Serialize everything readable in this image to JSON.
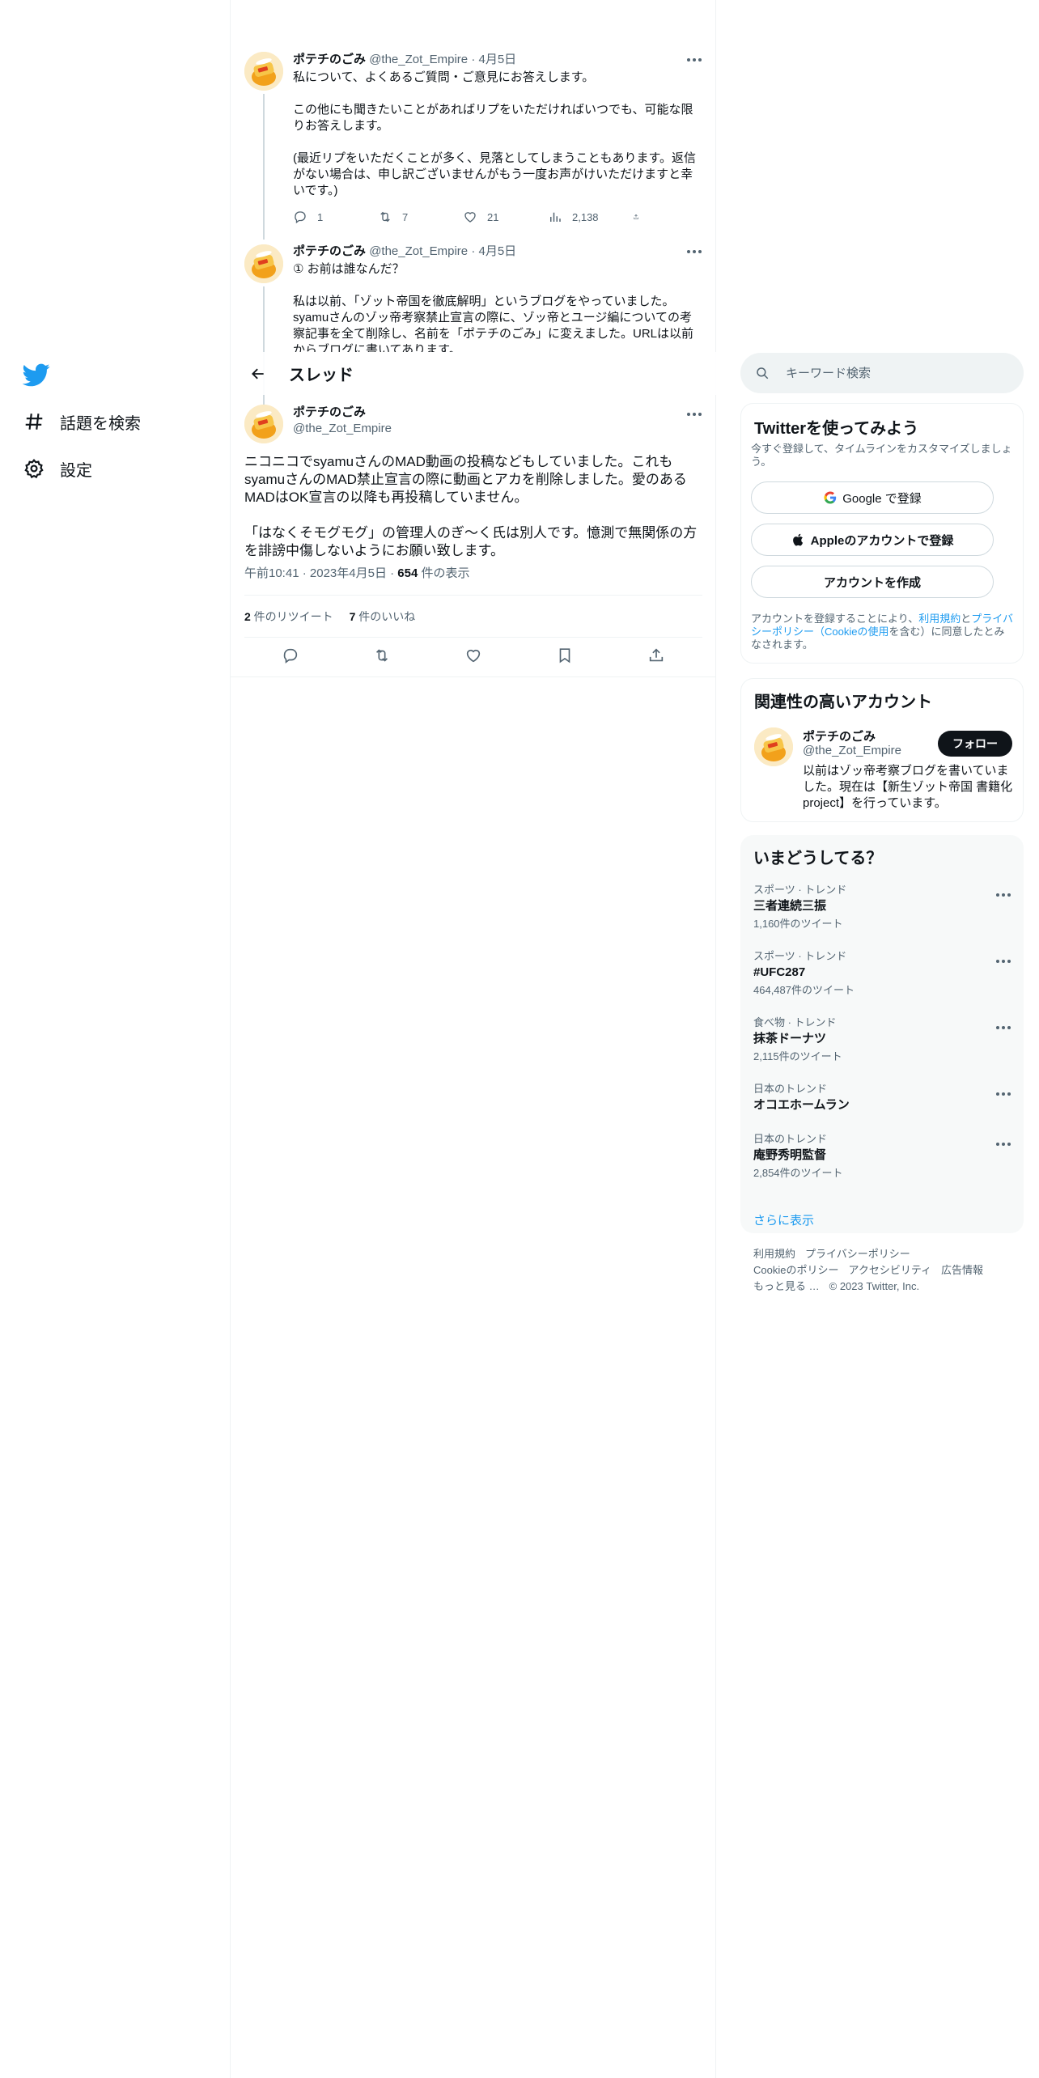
{
  "nav": {
    "items": [
      {
        "label": "話題を検索",
        "icon": "hashtag-icon"
      },
      {
        "label": "設定",
        "icon": "gear-icon"
      }
    ]
  },
  "thread": {
    "header_title": "スレッド",
    "previous": [
      {
        "name": "ポテチのごみ",
        "handle": "@the_Zot_Empire",
        "dot": "·",
        "date": "4月5日",
        "paragraphs": [
          "私について、よくあるご質問・ご意見にお答えします。",
          "この他にも聞きたいことがあればリプをいただければいつでも、可能な限りお答えします。",
          "(最近リプをいただくことが多く、見落としてしまうこともあります。返信がない場合は、申し訳ございませんがもう一度お声がけいただけますと幸いです。)"
        ],
        "replies": "1",
        "retweets": "7",
        "likes": "21",
        "views": "2,138"
      },
      {
        "name": "ポテチのごみ",
        "handle": "@the_Zot_Empire",
        "dot": "·",
        "date": "4月5日",
        "paragraphs": [
          "① お前は誰なんだ？",
          "私は以前、「ゾット帝国を徹底解明」というブログをやっていました。syamuさんのゾッ帝考察禁止宣言の際に、ゾッ帝とユージ編についての考察記事を全て削除し、名前を「ポテチのごみ」に変えました。URLは以前からブログに書いてあります。"
        ]
      }
    ],
    "main": {
      "name": "ポテチのごみ",
      "handle": "@the_Zot_Empire",
      "paragraphs": [
        "ニコニコでsyamuさんのMAD動画の投稿などもしていました。これもsyamuさんのMAD禁止宣言の際に動画とアカを削除しました。愛のあるMADはOK宣言の以降も再投稿していません。",
        "「はなくそモグモグ」の管理人のぎ～く氏は別人です。憶測で無関係の方を誹謗中傷しないようにお願い致します。"
      ],
      "time": "午前10:41",
      "date": "2023年4月5日",
      "sep": "·",
      "views_count": "654",
      "views_label": " 件の表示",
      "retweets_count": "2",
      "retweets_label": " 件のリツイート",
      "likes_count": "7",
      "likes_label": " 件のいいね"
    }
  },
  "search": {
    "placeholder": "キーワード検索"
  },
  "signup": {
    "title": "Twitterを使ってみよう",
    "subtitle": "今すぐ登録して、タイムラインをカスタマイズしましょう。",
    "google_label": "Google で登録",
    "apple_label": "Appleのアカウントで登録",
    "create_label": "アカウントを作成",
    "terms_prefix": "アカウントを登録することにより、",
    "terms_link1": "利用規約",
    "terms_and": "と",
    "terms_link2": "プライバシーポリシー（Cookieの使用",
    "terms_suffix": "を含む）に同意したとみなされます。"
  },
  "related": {
    "title": "関連性の高いアカウント",
    "name": "ポテチのごみ",
    "handle": "@the_Zot_Empire",
    "bio": "以前はゾッ帝考察ブログを書いていました。現在は【新生ゾット帝国 書籍化project】を行っています。",
    "follow_label": "フォロー"
  },
  "trends": {
    "title": "いまどうしてる？",
    "items": [
      {
        "category": "スポーツ · トレンド",
        "name": "三者連続三振",
        "count": "1,160件のツイート"
      },
      {
        "category": "スポーツ · トレンド",
        "name": "#UFC287",
        "count": "464,487件のツイート"
      },
      {
        "category": "食べ物 · トレンド",
        "name": "抹茶ドーナツ",
        "count": "2,115件のツイート"
      },
      {
        "category": "日本のトレンド",
        "name": "オコエホームラン",
        "count": ""
      },
      {
        "category": "日本のトレンド",
        "name": "庵野秀明監督",
        "count": "2,854件のツイート"
      }
    ],
    "show_more": "さらに表示"
  },
  "footer": {
    "links": [
      "利用規約",
      "プライバシーポリシー",
      "Cookieのポリシー",
      "アクセシビリティ",
      "広告情報",
      "もっと見る …"
    ],
    "copyright": "© 2023 Twitter, Inc."
  },
  "colors": {
    "accent": "#1d9bf0",
    "text": "#0f1419",
    "secondary": "#536471",
    "border": "#eff3f4"
  }
}
